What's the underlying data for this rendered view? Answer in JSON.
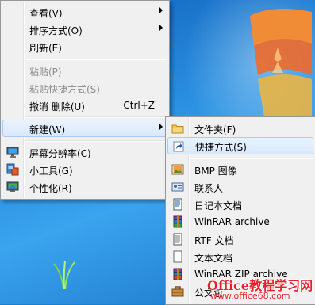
{
  "context_menu": {
    "items": [
      {
        "label": "查看(V)"
      },
      {
        "label": "排序方式(O)"
      },
      {
        "label": "刷新(E)"
      },
      {
        "label": "粘贴(P)"
      },
      {
        "label": "粘贴快捷方式(S)"
      },
      {
        "label": "撤消 删除(U)",
        "shortcut": "Ctrl+Z"
      },
      {
        "label": "新建(W)"
      },
      {
        "label": "屏幕分辨率(C)"
      },
      {
        "label": "小工具(G)"
      },
      {
        "label": "个性化(R)"
      }
    ]
  },
  "new_submenu": {
    "items": [
      {
        "label": "文件夹(F)"
      },
      {
        "label": "快捷方式(S)"
      },
      {
        "label": "BMP 图像"
      },
      {
        "label": "联系人"
      },
      {
        "label": "日记本文档"
      },
      {
        "label": "WinRAR archive"
      },
      {
        "label": "RTF 文档"
      },
      {
        "label": "文本文档"
      },
      {
        "label": "WinRAR ZIP archive"
      },
      {
        "label": "公文包"
      }
    ]
  },
  "watermark": {
    "title": "Office教程学习网",
    "url": "www.office68.com"
  },
  "colors": {
    "highlight_border": "#a8cbf1",
    "disabled_text": "#8a8a8a",
    "watermark": "#e8202a"
  }
}
